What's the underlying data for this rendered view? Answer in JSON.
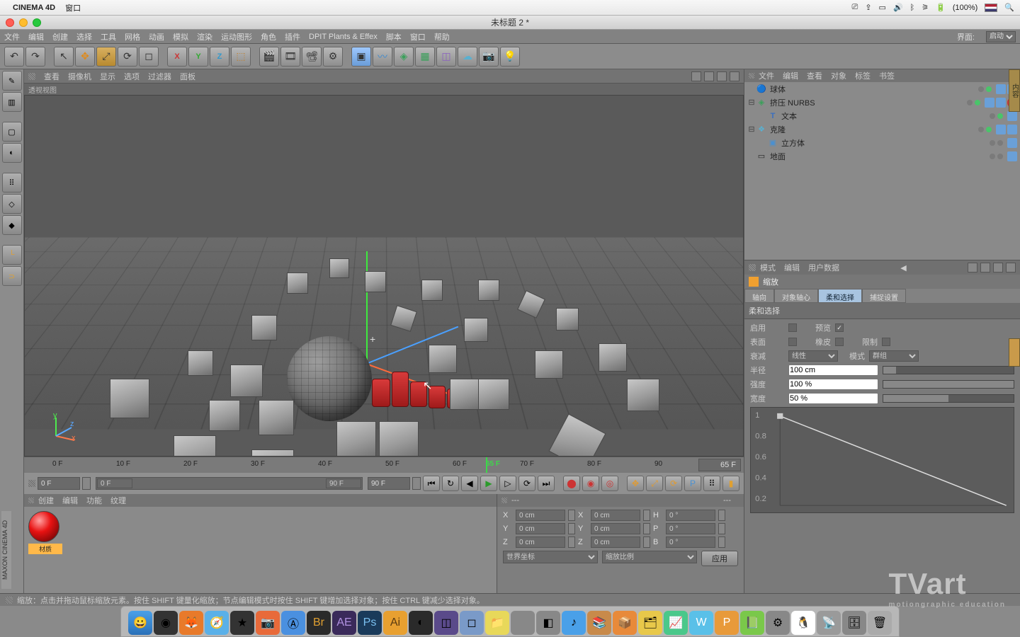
{
  "mac": {
    "app": "CINEMA 4D",
    "menu": "窗口",
    "battery": "(100%)"
  },
  "title": "未标题 2 *",
  "menu": [
    "文件",
    "编辑",
    "创建",
    "选择",
    "工具",
    "网格",
    "动画",
    "模拟",
    "渲染",
    "运动图形",
    "角色",
    "插件",
    "DPIT Plants & Effex",
    "脚本",
    "窗口",
    "帮助"
  ],
  "layout": {
    "label": "界面:",
    "value": "启动"
  },
  "vp_menu": [
    "查看",
    "摄像机",
    "显示",
    "选项",
    "过滤器",
    "面板"
  ],
  "vp_label": "透视视图",
  "time": {
    "ticks": [
      "0 F",
      "10 F",
      "20 F",
      "30 F",
      "40 F",
      "50 F",
      "60 F",
      "65 F",
      "70 F",
      "80 F",
      "90"
    ],
    "current": "65 F",
    "start": "0 F",
    "range_start": "0 F",
    "range_end": "90 F",
    "end": "90 F"
  },
  "mat_menu": [
    "创建",
    "编辑",
    "功能",
    "纹理"
  ],
  "mat_name": "材质",
  "coord": {
    "rows": [
      {
        "l": "X",
        "p": "0 cm",
        "s": "0 cm",
        "r": "H",
        "v": "0 °"
      },
      {
        "l": "Y",
        "p": "0 cm",
        "s": "0 cm",
        "r": "P",
        "v": "0 °"
      },
      {
        "l": "Z",
        "p": "0 cm",
        "s": "0 cm",
        "r": "B",
        "v": "0 °"
      }
    ],
    "sel1": "世界坐标",
    "sel2": "缩放比例",
    "apply": "应用"
  },
  "obj_menu": [
    "文件",
    "编辑",
    "查看",
    "对象",
    "标签",
    "书签"
  ],
  "objects": [
    {
      "name": "球体",
      "icon": "sphere",
      "ind": 0,
      "tags": 2
    },
    {
      "name": "挤压 NURBS",
      "icon": "nurbs",
      "ind": 0,
      "exp": "⊟",
      "tags": 3,
      "extra": "red"
    },
    {
      "name": "文本",
      "icon": "text",
      "ind": 1,
      "tags": 1
    },
    {
      "name": "克隆",
      "icon": "clone",
      "ind": 0,
      "exp": "⊟",
      "tags": 2
    },
    {
      "name": "立方体",
      "icon": "cube",
      "ind": 1,
      "tags": 1
    },
    {
      "name": "地面",
      "icon": "floor",
      "ind": 0,
      "tags": 1
    }
  ],
  "attr": {
    "menu": [
      "模式",
      "编辑",
      "用户数据"
    ],
    "title": "缩放",
    "tabs": [
      "轴向",
      "对象轴心",
      "柔和选择",
      "捕捉设置"
    ],
    "active_tab": 2,
    "section": "柔和选择",
    "rows": {
      "enable_l": "启用",
      "enable_v": "",
      "preview_l": "预览",
      "preview_chk": "✓",
      "surface_l": "表面",
      "rubber_l": "橡皮",
      "limit_l": "限制",
      "falloff_l": "衰减",
      "falloff_v": "线性",
      "mode_l": "模式",
      "mode_v": "群组",
      "radius_l": "半径",
      "radius_v": "100 cm",
      "strength_l": "强度",
      "strength_v": "100 %",
      "width_l": "宽度",
      "width_v": "50 %"
    },
    "axis": [
      "1",
      "0.8",
      "0.6",
      "0.4",
      "0.2"
    ]
  },
  "status": "缩放：点击并拖动鼠标缩放元素。按住 SHIFT 键量化缩放；节点编辑模式时按住 SHIFT 键增加选择对象；按住 CTRL 键减少选择对象。",
  "brand": "MAXON  CINEMA 4D"
}
